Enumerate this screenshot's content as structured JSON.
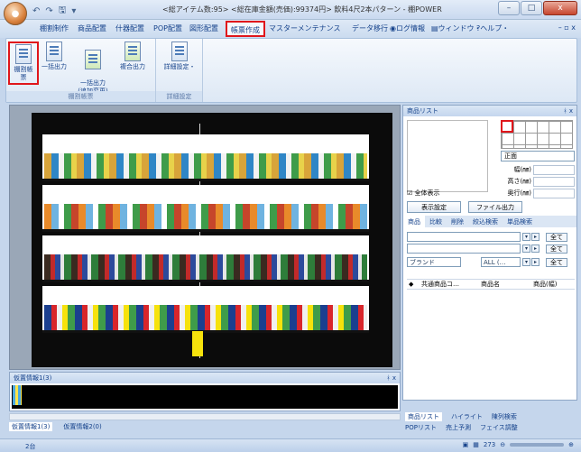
{
  "window": {
    "title": "<総アイテム数:95> <総在庫金額(売価):99374円> 飲料4尺2本パターン - 棚POWER",
    "qat": [
      "↶",
      "↷",
      "🖫",
      "▾"
    ],
    "buttons": [
      "–",
      "□",
      "x"
    ]
  },
  "menu": {
    "items": [
      "棚割制作",
      "商品配置",
      "什器配置",
      "POP配置",
      "図形配置",
      "帳票作成",
      "マスターメンテナンス",
      "データ移行",
      "◉ログ情報",
      "▤ウィンドウ・",
      "?ヘルプ・"
    ],
    "active_index": 5,
    "right_controls": "– ▫ x"
  },
  "ribbon": {
    "groups": [
      {
        "label": "棚割帳票",
        "buttons": [
          "棚割帳票",
          "一括出力",
          "一括出力\n(追加変更)",
          "複合出力"
        ]
      },
      {
        "label": "詳細設定",
        "buttons": [
          "詳細設定・"
        ]
      }
    ]
  },
  "right_panel": {
    "title": "商品リスト",
    "pin": "ᚼ x",
    "face_select": "正面",
    "dims": [
      "幅(㎜)",
      "高さ(㎜)",
      "奥行(㎜)"
    ],
    "show_all": "全体表示",
    "display_settings_btn": "表示設定",
    "file_output_btn": "ファイル出力",
    "tabs": [
      "商品",
      "比較",
      "削除",
      "絞込検索",
      "単品検索"
    ],
    "brand_combo": "ブランド",
    "all_combo": "ALL (…",
    "all_button": "全て",
    "list_headers": [
      "◆",
      "共通商品コ…",
      "商品名",
      "商品(幅)"
    ],
    "bottom_tabs_row1": [
      "商品リスト",
      "ハイライト",
      "陳列検索"
    ],
    "bottom_tabs_row2": [
      "POPリスト",
      "売上予測",
      "フェイス調整"
    ]
  },
  "bottom_pane": {
    "title": "仮置情報1(3)",
    "pin": "ᚼ x",
    "tabs": [
      "仮置情報1(3)",
      "仮置情報2(0)"
    ]
  },
  "status": {
    "left": "2台",
    "right": "273"
  },
  "colors": {
    "highlight": "#e0161b",
    "ribbon_bg": "#dde8f5",
    "frame": "#c5d6ec"
  }
}
